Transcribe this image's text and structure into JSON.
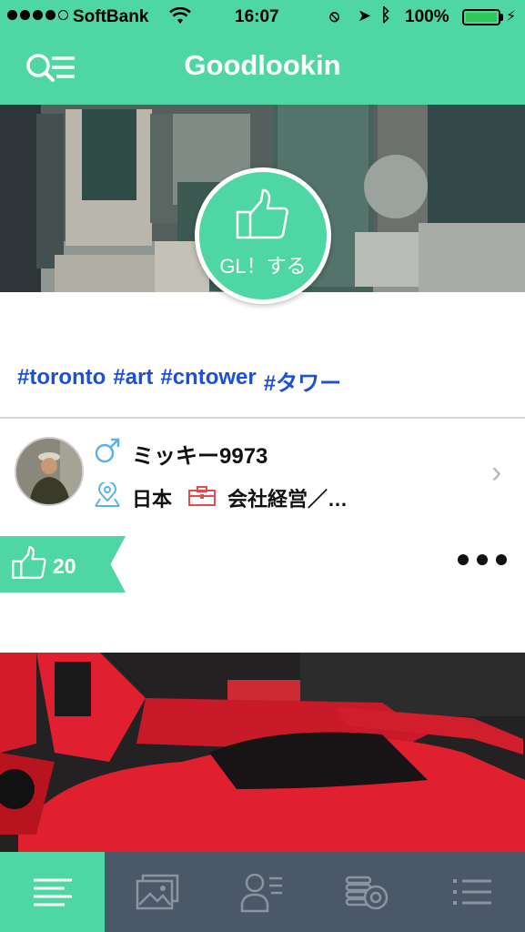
{
  "status_bar": {
    "carrier": "SoftBank",
    "time": "16:07",
    "battery_percent": "100%",
    "battery_level": 1.0
  },
  "nav": {
    "title": "Goodlookin",
    "menu_icon": "search-list-icon"
  },
  "post": {
    "gl_button_label": "GL！する",
    "hashtags": [
      "#toronto",
      "#art",
      "#cntower",
      "#タワー"
    ],
    "user": {
      "name": "ミッキー9973",
      "country": "日本",
      "occupation": "会社経営／…"
    },
    "likes_count": "20"
  },
  "tabs": [
    {
      "icon": "timeline-icon",
      "active": true
    },
    {
      "icon": "gallery-icon",
      "active": false
    },
    {
      "icon": "profile-list-icon",
      "active": false
    },
    {
      "icon": "coin-stack-icon",
      "active": false
    },
    {
      "icon": "list-icon",
      "active": false
    }
  ],
  "colors": {
    "accent": "#4fd6a5",
    "tabbar": "#4b5868",
    "hashtag": "#1d4fd8"
  }
}
